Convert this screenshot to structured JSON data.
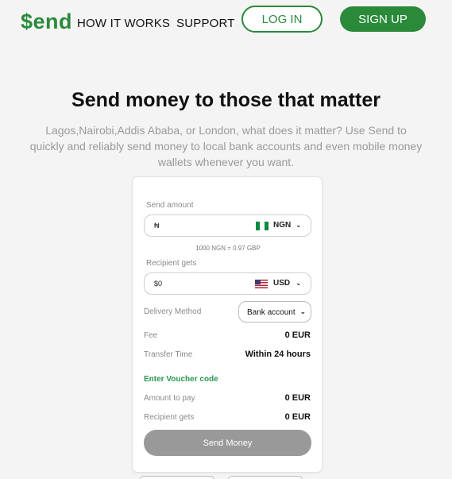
{
  "nav": {
    "logo": "$end",
    "links": [
      "HOW IT WORKS",
      "SUPPORT"
    ],
    "login_label": "LOG IN",
    "signup_label": "SIGN UP"
  },
  "hero": {
    "title": "Send money to those that matter",
    "subtitle": "Lagos,Nairobi,Addis Ababa, or London, what does it matter? Use Send to quickly and reliably send money to local bank accounts and even mobile money wallets whenever you want."
  },
  "form": {
    "send_amount": {
      "label": "Send amount",
      "prefix": "₦",
      "value": "",
      "currency": "NGN",
      "flag_icon": "nigeria-flag-icon"
    },
    "rate_text": "1000 NGN = 0.97 GBP",
    "recipient_gets_input": {
      "label": "Recipient gets",
      "prefix": "$0",
      "currency": "USD",
      "flag_icon": "us-flag-icon"
    },
    "delivery": {
      "label": "Delivery Method",
      "selected": "Bank account"
    },
    "fee": {
      "label": "Fee",
      "value": "0 EUR"
    },
    "transfer_time": {
      "label": "Transfer Time",
      "value": "Within 24 hours"
    },
    "voucher_label": "Enter Voucher code",
    "amount_to_pay": {
      "label": "Amount to pay",
      "value": "0 EUR"
    },
    "recipient_gets_total": {
      "label": "Recipient gets",
      "value": "0 EUR"
    },
    "submit_label": "Send Money"
  },
  "colors": {
    "brand_green": "#2a8a3a",
    "voucher_green": "#2a9a50",
    "disabled_button": "#999999",
    "muted_text": "#9a9a9a"
  }
}
